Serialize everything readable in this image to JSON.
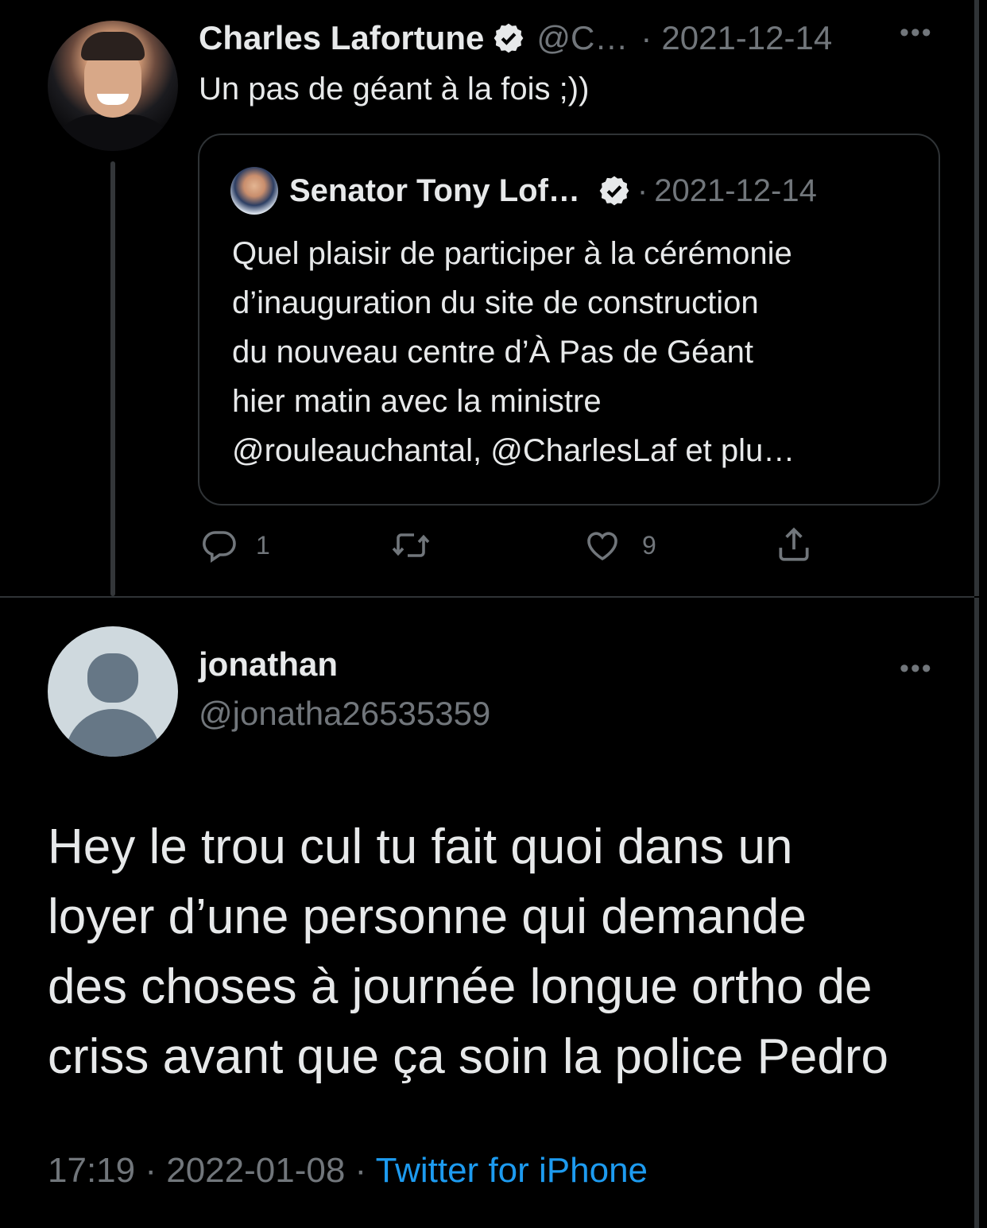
{
  "tweet1": {
    "author_name": "Charles Lafortune",
    "handle": "@C…",
    "separator": "·",
    "date": "2021-12-14",
    "text": "Un pas de géant à la fois ;))",
    "quote": {
      "author_name": "Senator Tony Lof…",
      "separator": "·",
      "date": "2021-12-14",
      "lines": [
        "Quel plaisir de participer à la cérémonie",
        "d’inauguration du site de construction",
        "du nouveau centre d’À Pas de Géant",
        "hier matin avec la ministre",
        "@rouleauchantal, @CharlesLaf et plu…"
      ]
    },
    "actions": {
      "reply_count": "1",
      "retweet_count": "",
      "like_count": "9"
    }
  },
  "tweet2": {
    "author_name": "jonathan",
    "handle": "@jonatha26535359",
    "lines": [
      "Hey le trou cul tu fait quoi dans un",
      "loyer d’une personne qui demande",
      "des choses à journée longue ortho de",
      "criss avant que ça soin la police Pedro"
    ],
    "time": "17:19",
    "separator": "·",
    "date": "2022-01-08",
    "source": "Twitter for iPhone"
  },
  "icons": [
    "verified-badge-icon",
    "more-icon",
    "reply-icon",
    "retweet-icon",
    "like-icon",
    "share-icon",
    "default-avatar-icon"
  ],
  "colors": {
    "background": "#000000",
    "text": "#e7e9ea",
    "muted": "#71767b",
    "link": "#1d9bf0",
    "border": "#2f3336"
  }
}
